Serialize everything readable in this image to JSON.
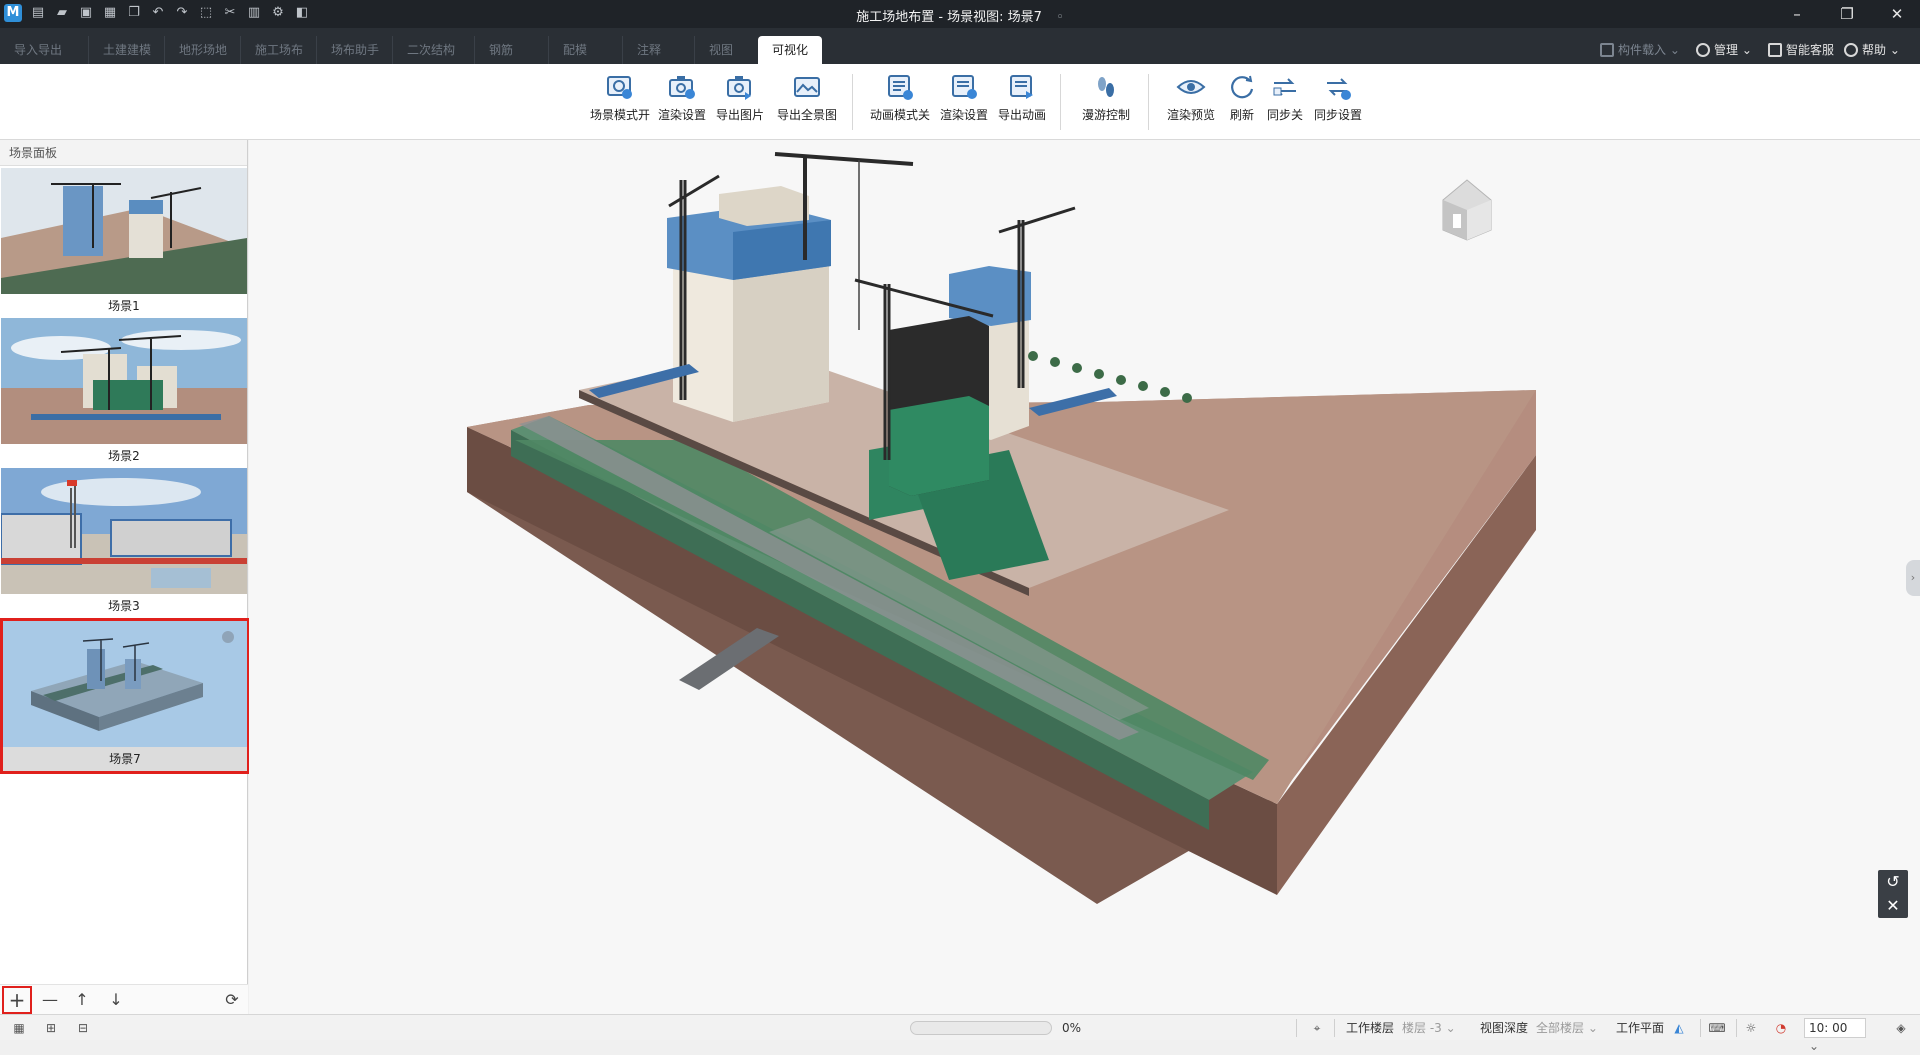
{
  "app": {
    "logo": "M",
    "title": "施工场地布置 - 场景视图: 场景7",
    "title_suffix": "◦",
    "window_buttons": [
      "minimize-icon",
      "restore-icon",
      "close-icon"
    ]
  },
  "quick_access": [
    "new-icon",
    "open-icon",
    "save-icon",
    "save-as-icon",
    "copy-icon",
    "undo-icon",
    "redo-icon",
    "select-icon",
    "cut-icon",
    "paste-icon",
    "settings-icon",
    "cube-icon"
  ],
  "tabs": [
    {
      "label": "导入导出"
    },
    {
      "label": "土建建模"
    },
    {
      "label": "地形场地"
    },
    {
      "label": "施工场布"
    },
    {
      "label": "场布助手"
    },
    {
      "label": "二次结构"
    },
    {
      "label": "钢筋"
    },
    {
      "label": "配模"
    },
    {
      "label": "注释"
    },
    {
      "label": "视图"
    },
    {
      "label": "可视化",
      "active": true
    }
  ],
  "tab_right": {
    "component_load": "构件载入",
    "manage": "管理",
    "service": "智能客服",
    "help": "帮助"
  },
  "ribbon": {
    "groups": [
      [
        {
          "label": "场景模式开",
          "icon": "scene-mode-icon"
        },
        {
          "label": "渲染设置",
          "icon": "render-settings-icon"
        },
        {
          "label": "导出图片",
          "icon": "export-image-icon"
        },
        {
          "label": "导出全景图",
          "icon": "export-panorama-icon"
        }
      ],
      [
        {
          "label": "动画模式关",
          "icon": "animation-mode-icon"
        },
        {
          "label": "渲染设置",
          "icon": "render-settings-icon"
        },
        {
          "label": "导出动画",
          "icon": "export-animation-icon"
        }
      ],
      [
        {
          "label": "漫游控制",
          "icon": "roam-control-icon"
        }
      ],
      [
        {
          "label": "渲染预览",
          "icon": "render-preview-icon"
        },
        {
          "label": "刷新",
          "icon": "refresh-icon"
        },
        {
          "label": "同步关",
          "icon": "sync-off-icon"
        },
        {
          "label": "同步设置",
          "icon": "sync-settings-icon"
        }
      ]
    ]
  },
  "scene_panel": {
    "header": "场景面板",
    "scenes": [
      {
        "label": "场景1"
      },
      {
        "label": "场景2"
      },
      {
        "label": "场景3"
      },
      {
        "label": "场景7",
        "selected": true
      }
    ],
    "footer_buttons": [
      "+",
      "—",
      "↑",
      "↓",
      "⟳"
    ]
  },
  "viewport": {
    "nav_cube": "home-view-cube-icon",
    "side_tab": "›",
    "tools": [
      "↺",
      "✕"
    ]
  },
  "statusbar": {
    "progress_value": 0,
    "progress_text": "0%",
    "work_floor_label": "工作楼层",
    "work_floor_value": "楼层 -3",
    "view_depth_label": "视图深度",
    "view_depth_value": "全部楼层",
    "work_plane_label": "工作平面",
    "time_value": "10: 00"
  }
}
